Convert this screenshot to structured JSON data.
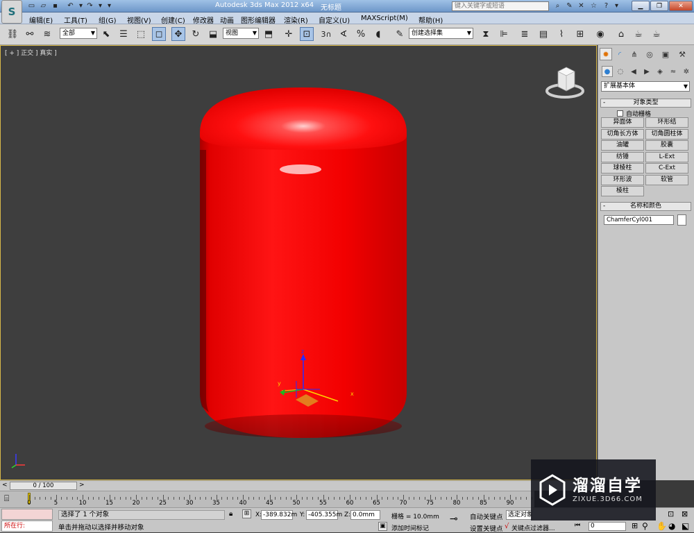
{
  "titlebar": {
    "app_title": "Autodesk 3ds Max  2012 x64",
    "file_name": "无标题",
    "search_placeholder": "键入关键字或短语"
  },
  "menu": [
    "编辑(E)",
    "工具(T)",
    "组(G)",
    "视图(V)",
    "创建(C)",
    "修改器",
    "动画",
    "图形编辑器",
    "渲染(R)",
    "自定义(U)",
    "MAXScript(M)",
    "帮助(H)"
  ],
  "toolbar": {
    "selection_filter": "全部",
    "ref_coord": "视图",
    "named_selection": "创建选择集",
    "snap_label": "3"
  },
  "viewport": {
    "label": "[ + ] 正交 ] 真实 ]",
    "object_color": "#ff0000",
    "axis_x": "x",
    "axis_y": "y",
    "axis_z": "z"
  },
  "panel": {
    "category": "扩展基本体",
    "rollout_object_type": "对象类型",
    "auto_grid": "自动栅格",
    "buttons": [
      [
        "异面体",
        "环形结"
      ],
      [
        "切角长方体",
        "切角圆柱体"
      ],
      [
        "油罐",
        "胶囊"
      ],
      [
        "纺锤",
        "L-Ext"
      ],
      [
        "球棱柱",
        "C-Ext"
      ],
      [
        "环形波",
        "软管"
      ],
      [
        "棱柱",
        ""
      ]
    ],
    "rollout_name_color": "名称和颜色",
    "object_name": "ChamferCyl001",
    "object_swatch": "#ffffff"
  },
  "timeline": {
    "frame_display": "0 / 100",
    "ticks": [
      "0",
      "5",
      "10",
      "15",
      "20",
      "25",
      "30",
      "35",
      "40",
      "45",
      "50",
      "55",
      "60",
      "65",
      "70",
      "75",
      "80",
      "85",
      "90"
    ]
  },
  "status": {
    "listener": "所在行:",
    "selection": "选择了 1 个对象",
    "prompt": "单击并拖动以选择并移动对象",
    "x_label": "X:",
    "x": "-389.832m",
    "y_label": "Y:",
    "y": "-405.355m",
    "z_label": "Z:",
    "z": "0.0mm",
    "grid": "栅格 = 10.0mm",
    "add_time_tag": "添加时间标记",
    "auto_key": "自动关键点",
    "set_key": "设置关键点",
    "selected_set": "选定对象",
    "key_filters": "关键点过滤器...",
    "frame": "0"
  },
  "watermark": {
    "title": "溜溜自学",
    "url": "ZIXUE.3D66.COM"
  }
}
